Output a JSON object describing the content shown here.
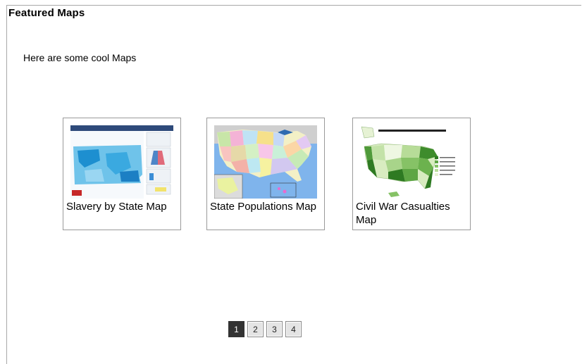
{
  "panel": {
    "title": "Featured Maps",
    "intro": "Here are some cool Maps"
  },
  "cards": [
    {
      "label": "Slavery by State Map",
      "thumb_icon": "pennsylvania-census-map-thumbnail"
    },
    {
      "label": "State Populations Map",
      "thumb_icon": "us-states-political-map-thumbnail"
    },
    {
      "label": "Civil War Casualties Map",
      "thumb_icon": "us-population-green-map-thumbnail"
    }
  ],
  "pager": {
    "pages": [
      "1",
      "2",
      "3",
      "4"
    ],
    "current": "1"
  },
  "colors": {
    "active_page": "#333333",
    "page_button": "#e4e4e4",
    "border": "#a8a8a8"
  }
}
